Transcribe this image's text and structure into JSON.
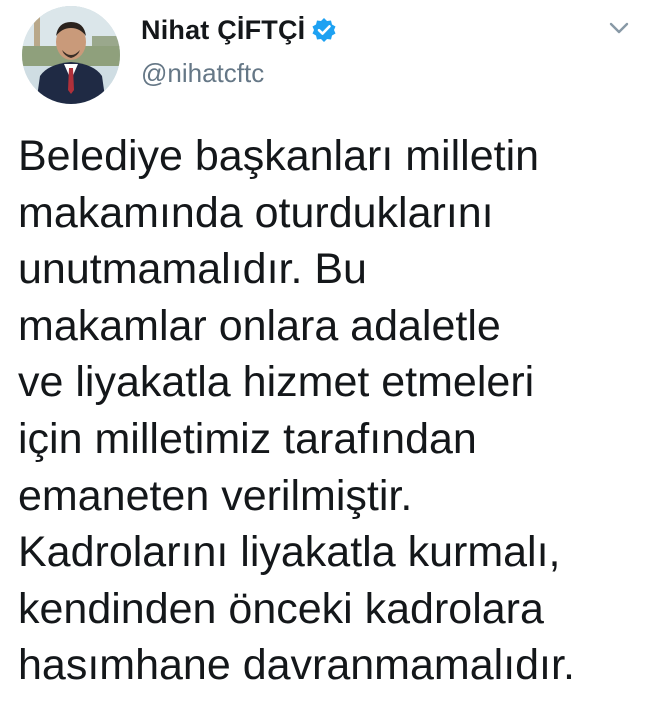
{
  "tweet": {
    "author": {
      "display_name": "Nihat ÇİFTÇİ",
      "handle": "@nihatcftc",
      "verified": true
    },
    "icons": {
      "verified": "verified-badge-icon",
      "menu": "chevron-down-icon"
    },
    "accent_color": "#1da1f2",
    "text_lines": [
      "Belediye başkanları milletin",
      "makamında oturduklarını",
      "unutmamalıdır. Bu",
      "makamlar onlara adaletle",
      "ve liyakatla hizmet etmeleri",
      "için milletimiz tarafından",
      "emaneten verilmiştir.",
      "Kadrolarını liyakatla kurmalı,",
      "kendinden önceki kadrolara",
      "hasımhane davranmamalıdır."
    ]
  }
}
